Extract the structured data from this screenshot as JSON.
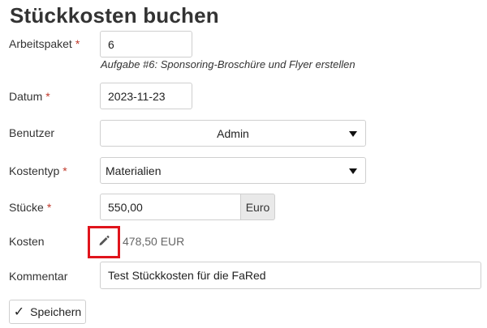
{
  "page": {
    "title": "Stückkosten buchen"
  },
  "required_marker": "*",
  "fields": {
    "arbeitspaket": {
      "label": "Arbeitspaket",
      "value": "6",
      "hint": "Aufgabe #6: Sponsoring-Broschüre und Flyer erstellen"
    },
    "datum": {
      "label": "Datum",
      "value": "2023-11-23"
    },
    "benutzer": {
      "label": "Benutzer",
      "selected": "Admin"
    },
    "kostentyp": {
      "label": "Kostentyp",
      "selected": "Materialien"
    },
    "stuecke": {
      "label": "Stücke",
      "value": "550,00",
      "unit": "Euro"
    },
    "kosten": {
      "label": "Kosten",
      "value": "478,50 EUR",
      "edit_icon": "pencil-icon"
    },
    "kommentar": {
      "label": "Kommentar",
      "value": "Test Stückkosten für die FaRed"
    }
  },
  "actions": {
    "save_label": "Speichern",
    "save_icon": "check-icon"
  },
  "colors": {
    "highlight": "#e0141c",
    "required": "#c0392b",
    "addon_bg": "#e9e9e9"
  }
}
